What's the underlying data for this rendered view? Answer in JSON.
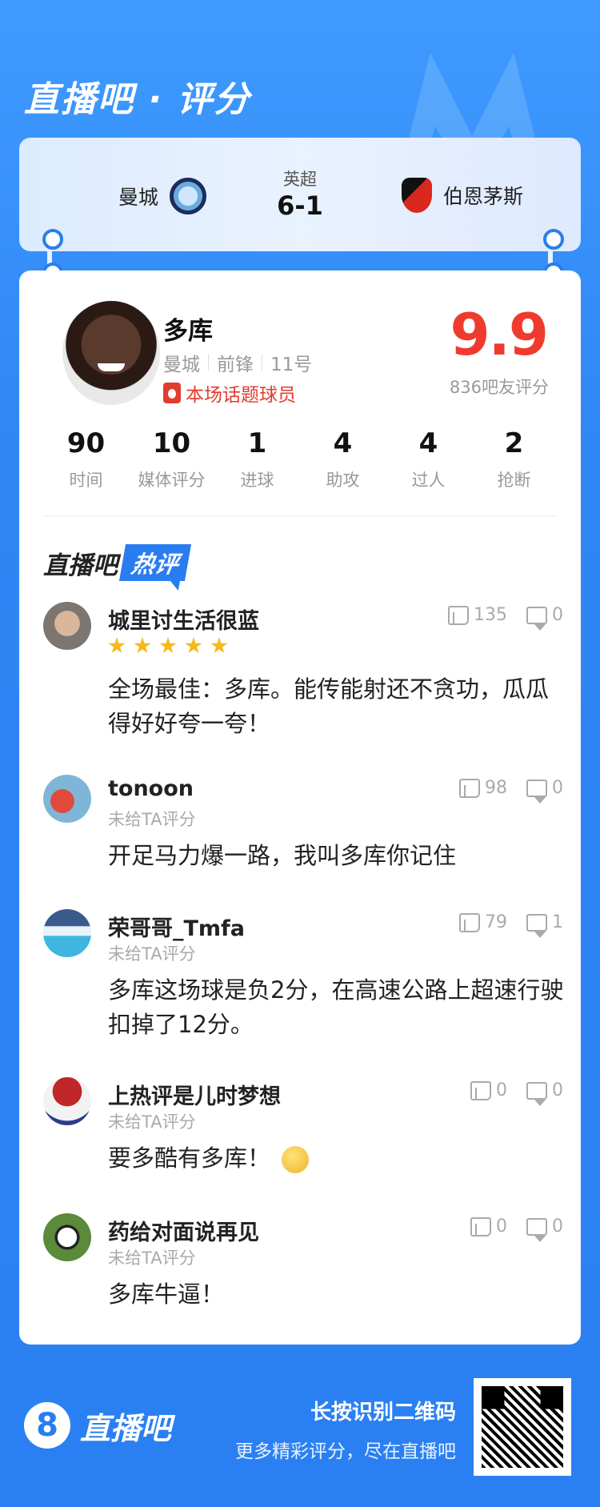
{
  "header": {
    "brand_title": "直播吧 · 评分"
  },
  "match": {
    "league": "英超",
    "score": "6-1",
    "home_team": "曼城",
    "away_team": "伯恩茅斯"
  },
  "player": {
    "name": "多库",
    "team": "曼城",
    "position": "前锋",
    "number": "11号",
    "tag": "本场话题球员",
    "rating": "9.9",
    "rating_sub": "836吧友评分",
    "stats": [
      {
        "value": "90",
        "label": "时间"
      },
      {
        "value": "10",
        "label": "媒体评分"
      },
      {
        "value": "1",
        "label": "进球"
      },
      {
        "value": "4",
        "label": "助攻"
      },
      {
        "value": "4",
        "label": "过人"
      },
      {
        "value": "2",
        "label": "抢断"
      }
    ]
  },
  "hot_comments": {
    "title_a": "直播吧",
    "title_b": "热评",
    "items": [
      {
        "user": "城里讨生活很蓝",
        "stars": 5,
        "sub": "",
        "text": "全场最佳：多库。能传能射还不贪功，瓜瓜得好好夸一夸！",
        "likes": "135",
        "dislikes": "0"
      },
      {
        "user": "tonoon",
        "sub": "未给TA评分",
        "text": "开足马力爆一路，我叫多库你记住",
        "likes": "98",
        "dislikes": "0"
      },
      {
        "user": "荣哥哥_Tmfa",
        "sub": "未给TA评分",
        "text": "多库这场球是负2分，在高速公路上超速行驶扣掉了12分。",
        "likes": "79",
        "dislikes": "1"
      },
      {
        "user": "上热评是儿时梦想",
        "sub": "未给TA评分",
        "text": "要多酷有多库！",
        "likes": "0",
        "dislikes": "0"
      },
      {
        "user": "药给对面说再见",
        "sub": "未给TA评分",
        "text": "多库牛逼！",
        "likes": "0",
        "dislikes": "0"
      }
    ]
  },
  "footer": {
    "logo_number": "8",
    "logo_text": "直播吧",
    "line1": "长按识别二维码",
    "line2": "更多精彩评分，尽在直播吧"
  },
  "colors": {
    "brand_blue": "#2a80f2",
    "rating_red": "#ef3b2e",
    "star_gold": "#f6b91c"
  }
}
